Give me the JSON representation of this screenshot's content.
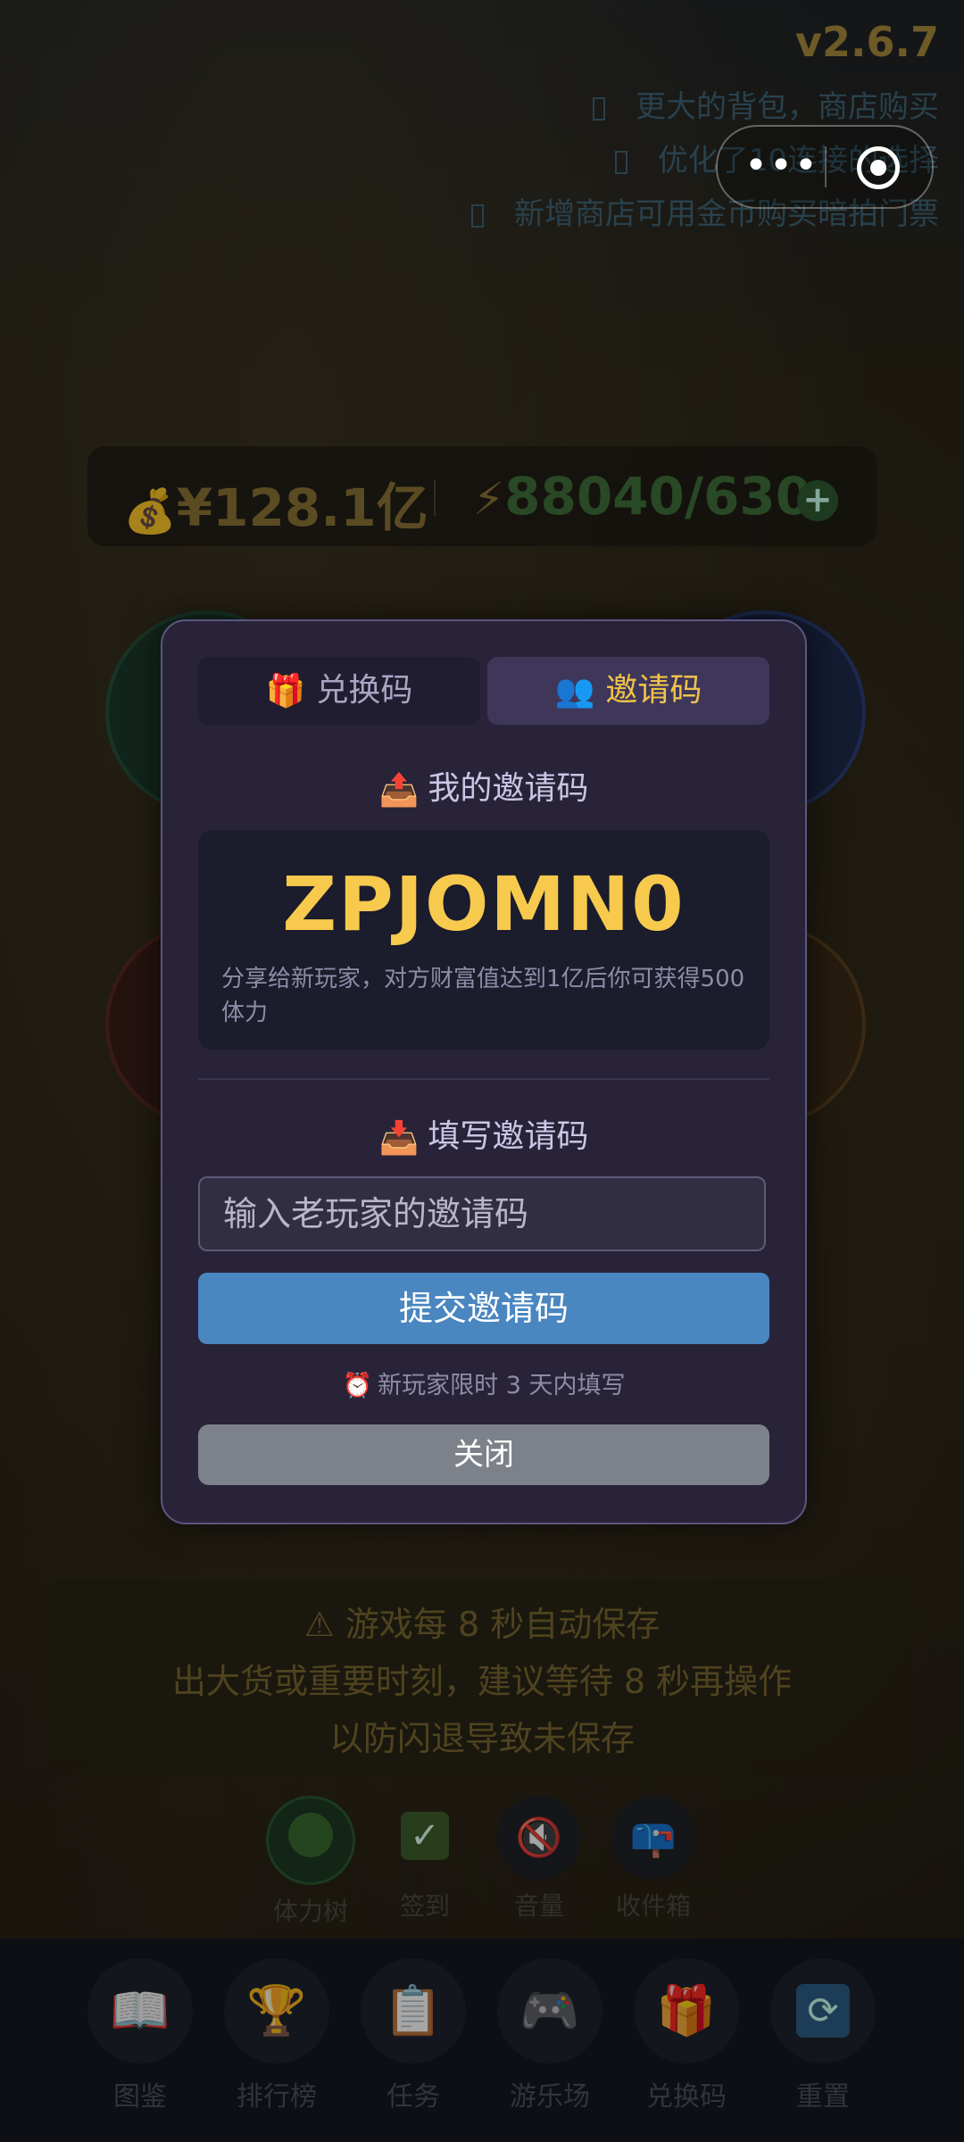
{
  "header": {
    "version": "v2.6.7",
    "updates": [
      "更大的背包，商店购买",
      "优化了10连接的选择",
      "新增商店可用金币购买暗拍门票"
    ]
  },
  "stats": {
    "money_icon": "money-bag-icon",
    "money": "¥128.1亿",
    "energy_icon": "lightning-icon",
    "energy": "88040/630",
    "add_icon": "plus-circle-icon"
  },
  "modal": {
    "tabs": [
      {
        "label": "兑换码",
        "icon": "gift-icon",
        "active": false
      },
      {
        "label": "邀请码",
        "icon": "users-icon",
        "active": true
      }
    ],
    "my_code_title": "我的邀请码",
    "my_code": "ZPJOMN0",
    "my_code_desc": "分享给新玩家，对方财富值达到1亿后你可获得500 体力",
    "fill_title": "填写邀请码",
    "input_placeholder": "输入老玩家的邀请码",
    "submit_label": "提交邀请码",
    "hint": "新玩家限时 3 天内填写",
    "close_label": "关闭"
  },
  "warning": {
    "line1": "游戏每 8 秒自动保存",
    "line2": "出大货或重要时刻，建议等待 8 秒再操作",
    "line3": "以防闪退导致未保存"
  },
  "mini_actions": [
    {
      "label": "体力树",
      "icon": "tree-icon"
    },
    {
      "label": "签到",
      "icon": "checkmark-icon"
    },
    {
      "label": "音量",
      "icon": "mute-icon"
    },
    {
      "label": "收件箱",
      "icon": "mailbox-icon"
    }
  ],
  "nav": [
    {
      "label": "图鉴",
      "icon": "book-icon"
    },
    {
      "label": "排行榜",
      "icon": "trophy-icon"
    },
    {
      "label": "任务",
      "icon": "clipboard-icon"
    },
    {
      "label": "游乐场",
      "icon": "gamepad-icon"
    },
    {
      "label": "兑换码",
      "icon": "gift-icon"
    },
    {
      "label": "重置",
      "icon": "refresh-icon"
    }
  ]
}
